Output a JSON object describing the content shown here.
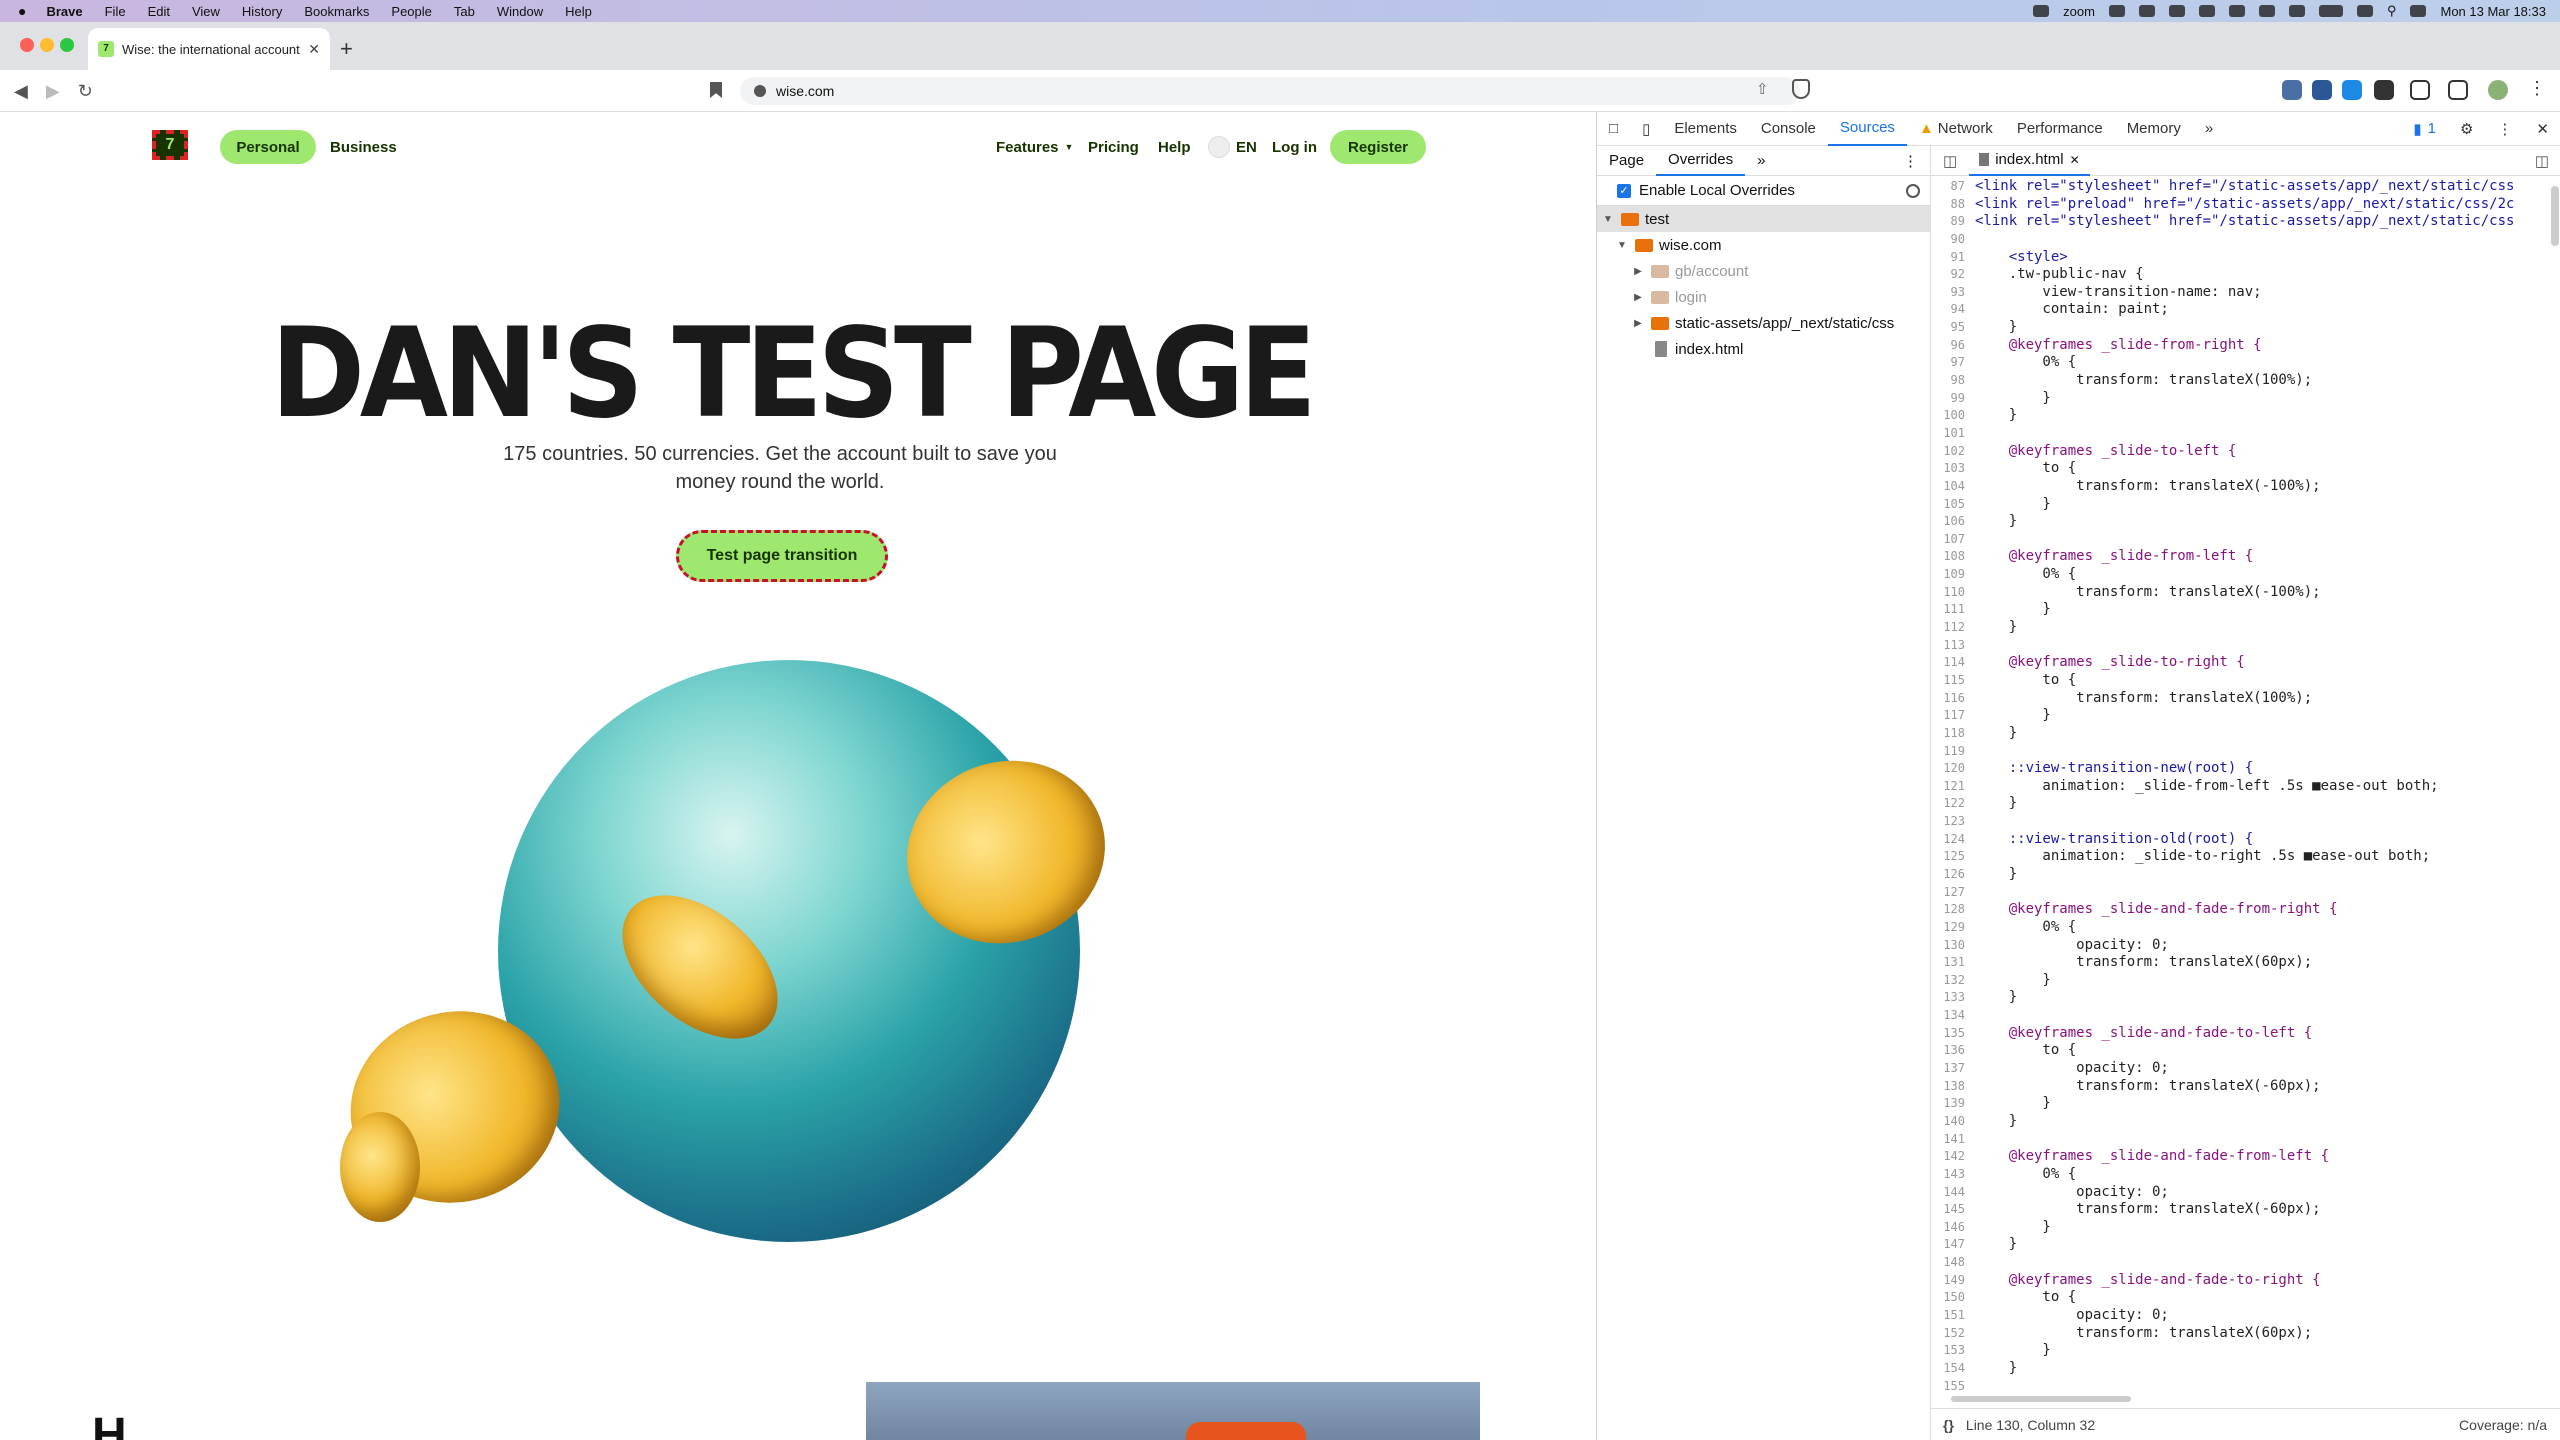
{
  "menubar": {
    "items": [
      "Brave",
      "File",
      "Edit",
      "View",
      "History",
      "Bookmarks",
      "People",
      "Tab",
      "Window",
      "Help"
    ],
    "zoom_label": "zoom",
    "datetime": "Mon 13 Mar  18:33"
  },
  "browser": {
    "tab_title": "Wise: the international account",
    "url": "wise.com"
  },
  "page": {
    "nav": {
      "personal": "Personal",
      "business": "Business",
      "features": "Features",
      "pricing": "Pricing",
      "help": "Help",
      "lang": "EN",
      "login": "Log in",
      "register": "Register"
    },
    "hero_title": "DAN'S TEST PAGE",
    "hero_sub_line1": "175 countries. 50 currencies. Get the account built to save you",
    "hero_sub_line2": "money round the world.",
    "cta": "Test page transition",
    "bottom_letter": "H"
  },
  "devtools": {
    "tabs": [
      "Elements",
      "Console",
      "Sources",
      "Network",
      "Performance",
      "Memory"
    ],
    "active_tab": "Sources",
    "issues_count": "1",
    "left_subtabs": [
      "Page",
      "Overrides"
    ],
    "enable_overrides": "Enable Local Overrides",
    "tree": {
      "root": "test",
      "domain": "wise.com",
      "folders": [
        "gb/account",
        "login",
        "static-assets/app/_next/static/css"
      ],
      "file": "index.html"
    },
    "editor_tab": "index.html",
    "status_position": "Line 130, Column 32",
    "coverage": "Coverage: n/a",
    "code_lines": [
      {
        "n": "87",
        "t": "<link rel=\"stylesheet\" href=\"/static-assets/app/_next/static/css"
      },
      {
        "n": "88",
        "t": "<link rel=\"preload\" href=\"/static-assets/app/_next/static/css/2c"
      },
      {
        "n": "89",
        "t": "<link rel=\"stylesheet\" href=\"/static-assets/app/_next/static/css"
      },
      {
        "n": "90",
        "t": ""
      },
      {
        "n": "91",
        "t": "    <style>"
      },
      {
        "n": "92",
        "t": "    .tw-public-nav {"
      },
      {
        "n": "93",
        "t": "        view-transition-name: nav;"
      },
      {
        "n": "94",
        "t": "        contain: paint;"
      },
      {
        "n": "95",
        "t": "    }"
      },
      {
        "n": "96",
        "t": "    @keyframes _slide-from-right {"
      },
      {
        "n": "97",
        "t": "        0% {"
      },
      {
        "n": "98",
        "t": "            transform: translateX(100%);"
      },
      {
        "n": "99",
        "t": "        }"
      },
      {
        "n": "100",
        "t": "    }"
      },
      {
        "n": "101",
        "t": ""
      },
      {
        "n": "102",
        "t": "    @keyframes _slide-to-left {"
      },
      {
        "n": "103",
        "t": "        to {"
      },
      {
        "n": "104",
        "t": "            transform: translateX(-100%);"
      },
      {
        "n": "105",
        "t": "        }"
      },
      {
        "n": "106",
        "t": "    }"
      },
      {
        "n": "107",
        "t": ""
      },
      {
        "n": "108",
        "t": "    @keyframes _slide-from-left {"
      },
      {
        "n": "109",
        "t": "        0% {"
      },
      {
        "n": "110",
        "t": "            transform: translateX(-100%);"
      },
      {
        "n": "111",
        "t": "        }"
      },
      {
        "n": "112",
        "t": "    }"
      },
      {
        "n": "113",
        "t": ""
      },
      {
        "n": "114",
        "t": "    @keyframes _slide-to-right {"
      },
      {
        "n": "115",
        "t": "        to {"
      },
      {
        "n": "116",
        "t": "            transform: translateX(100%);"
      },
      {
        "n": "117",
        "t": "        }"
      },
      {
        "n": "118",
        "t": "    }"
      },
      {
        "n": "119",
        "t": ""
      },
      {
        "n": "120",
        "t": "    ::view-transition-new(root) {"
      },
      {
        "n": "121",
        "t": "        animation: _slide-from-left .5s ■ease-out both;"
      },
      {
        "n": "122",
        "t": "    }"
      },
      {
        "n": "123",
        "t": ""
      },
      {
        "n": "124",
        "t": "    ::view-transition-old(root) {"
      },
      {
        "n": "125",
        "t": "        animation: _slide-to-right .5s ■ease-out both;"
      },
      {
        "n": "126",
        "t": "    }"
      },
      {
        "n": "127",
        "t": ""
      },
      {
        "n": "128",
        "t": "    @keyframes _slide-and-fade-from-right {"
      },
      {
        "n": "129",
        "t": "        0% {"
      },
      {
        "n": "130",
        "t": "            opacity: 0;"
      },
      {
        "n": "131",
        "t": "            transform: translateX(60px);"
      },
      {
        "n": "132",
        "t": "        }"
      },
      {
        "n": "133",
        "t": "    }"
      },
      {
        "n": "134",
        "t": ""
      },
      {
        "n": "135",
        "t": "    @keyframes _slide-and-fade-to-left {"
      },
      {
        "n": "136",
        "t": "        to {"
      },
      {
        "n": "137",
        "t": "            opacity: 0;"
      },
      {
        "n": "138",
        "t": "            transform: translateX(-60px);"
      },
      {
        "n": "139",
        "t": "        }"
      },
      {
        "n": "140",
        "t": "    }"
      },
      {
        "n": "141",
        "t": ""
      },
      {
        "n": "142",
        "t": "    @keyframes _slide-and-fade-from-left {"
      },
      {
        "n": "143",
        "t": "        0% {"
      },
      {
        "n": "144",
        "t": "            opacity: 0;"
      },
      {
        "n": "145",
        "t": "            transform: translateX(-60px);"
      },
      {
        "n": "146",
        "t": "        }"
      },
      {
        "n": "147",
        "t": "    }"
      },
      {
        "n": "148",
        "t": ""
      },
      {
        "n": "149",
        "t": "    @keyframes _slide-and-fade-to-right {"
      },
      {
        "n": "150",
        "t": "        to {"
      },
      {
        "n": "151",
        "t": "            opacity: 0;"
      },
      {
        "n": "152",
        "t": "            transform: translateX(60px);"
      },
      {
        "n": "153",
        "t": "        }"
      },
      {
        "n": "154",
        "t": "    }"
      },
      {
        "n": "155",
        "t": ""
      }
    ]
  },
  "colors": {
    "wise_green": "#9fe870",
    "wise_dark": "#163300",
    "devtools_accent": "#1a73e8",
    "folder": "#e8710a"
  }
}
